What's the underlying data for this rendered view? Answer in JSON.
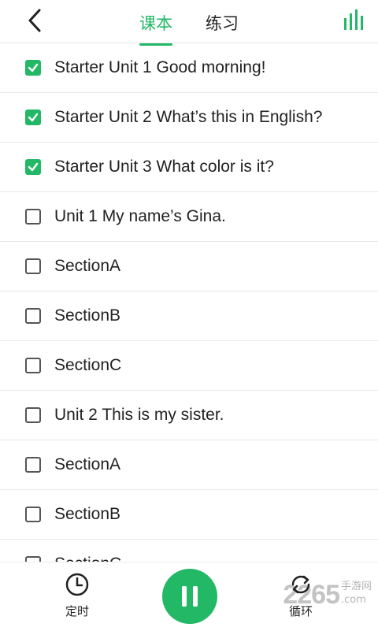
{
  "header": {
    "tabs": [
      {
        "label": "课本",
        "active": true
      },
      {
        "label": "练习",
        "active": false
      }
    ]
  },
  "list": {
    "items": [
      {
        "label": "Starter Unit 1 Good morning!",
        "checked": true
      },
      {
        "label": "Starter Unit 2 What’s this in English?",
        "checked": true
      },
      {
        "label": "Starter Unit 3 What color is it?",
        "checked": true
      },
      {
        "label": "Unit 1 My name’s Gina.",
        "checked": false
      },
      {
        "label": "SectionA",
        "checked": false
      },
      {
        "label": "SectionB",
        "checked": false
      },
      {
        "label": "SectionC",
        "checked": false
      },
      {
        "label": "Unit 2 This is my sister.",
        "checked": false
      },
      {
        "label": "SectionA",
        "checked": false
      },
      {
        "label": "SectionB",
        "checked": false
      },
      {
        "label": "SectionC",
        "checked": false
      }
    ]
  },
  "footer": {
    "timer_label": "定时",
    "loop_label": "循环"
  },
  "watermark": {
    "number": "2265",
    "domain": ".com",
    "site_name": "手游网"
  },
  "colors": {
    "accent": "#22b866"
  },
  "icons": [
    "chevron-left-icon",
    "bars-icon",
    "clock-icon",
    "pause-icon",
    "loop-icon",
    "check-icon"
  ]
}
